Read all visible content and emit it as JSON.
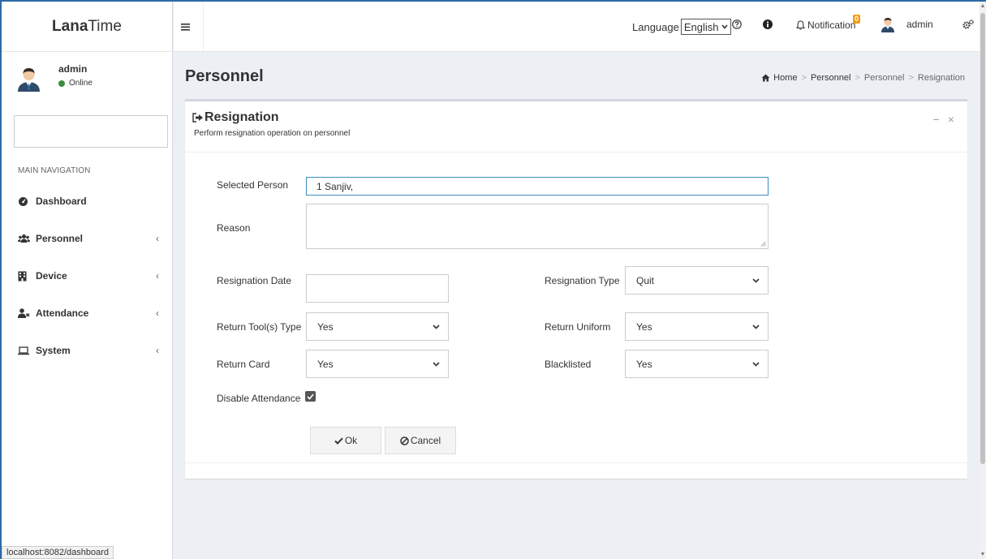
{
  "app": {
    "logo_bold": "Lana",
    "logo_rest": "Time"
  },
  "sidebar": {
    "user_name": "admin",
    "user_status": "Online",
    "nav_header": "MAIN NAVIGATION",
    "items": [
      {
        "label": "Dashboard",
        "icon": "dashboard-icon"
      },
      {
        "label": "Personnel",
        "icon": "users-icon"
      },
      {
        "label": "Device",
        "icon": "building-icon"
      },
      {
        "label": "Attendance",
        "icon": "user-x-icon"
      },
      {
        "label": "System",
        "icon": "laptop-icon"
      }
    ]
  },
  "topbar": {
    "language_label": "Language",
    "language_value": "English",
    "notification_label": "Notification",
    "notification_count": "0",
    "admin_label": "admin"
  },
  "page": {
    "title": "Personnel",
    "breadcrumb": [
      "Home",
      "Personnel",
      "Personnel",
      "Resignation"
    ]
  },
  "box": {
    "title": "Resignation",
    "subtitle": "Perform resignation operation on personnel"
  },
  "form": {
    "selected_person_label": "Selected Person",
    "selected_person_value": "1 Sanjiv,",
    "reason_label": "Reason",
    "reason_value": "",
    "resignation_date_label": "Resignation Date",
    "resignation_date_value": "",
    "resignation_type_label": "Resignation Type",
    "resignation_type_value": "Quit",
    "return_tools_label": "Return Tool(s) Type",
    "return_tools_value": "Yes",
    "return_uniform_label": "Return Uniform",
    "return_uniform_value": "Yes",
    "return_card_label": "Return Card",
    "return_card_value": "Yes",
    "blacklisted_label": "Blacklisted",
    "blacklisted_value": "Yes",
    "disable_attendance_label": "Disable Attendance",
    "disable_attendance_checked": true,
    "ok_label": "Ok",
    "cancel_label": "Cancel"
  },
  "status_bar": {
    "url": "localhost:8082/dashboard"
  },
  "colors": {
    "accent": "#3c8dbc",
    "online": "#3c8d3c",
    "badge": "#f39c12",
    "frame": "#2c6aa5"
  }
}
